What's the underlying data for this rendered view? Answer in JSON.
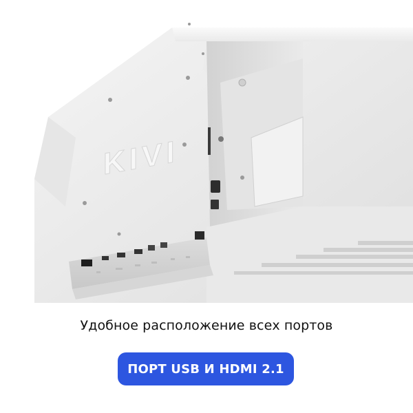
{
  "photo": {
    "logo_text": "KIVI"
  },
  "caption": "Удобное расположение всех портов",
  "badge": {
    "label": "ПОРТ USB И HDMI 2.1"
  },
  "colors": {
    "badge_bg": "#2d56e0",
    "caption_text": "#111111",
    "tv_body": "#eeeeee"
  }
}
